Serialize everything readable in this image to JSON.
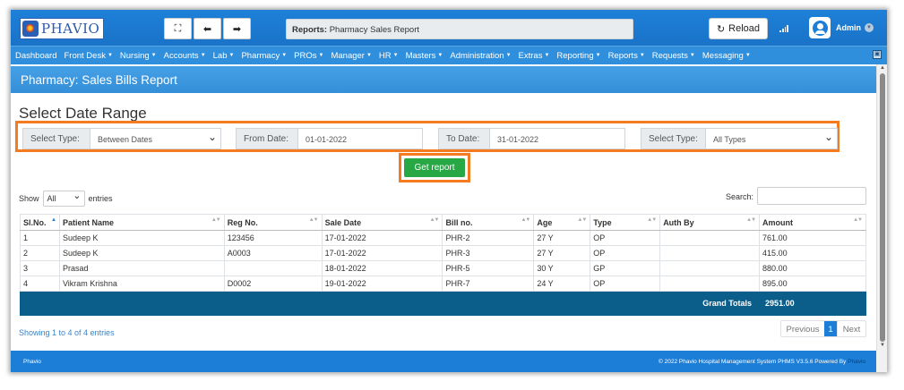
{
  "app": {
    "logo_text": "PHAVIO",
    "breadcrumb_prefix": "Reports:",
    "breadcrumb_page": "Pharmacy Sales Report",
    "reload_label": "Reload",
    "user": "Admin"
  },
  "toolbar": {
    "expand_icon": "expand-icon",
    "back_icon": "arrow-left-icon",
    "forward_icon": "arrow-right-icon"
  },
  "nav": [
    {
      "label": "Dashboard",
      "caret": false
    },
    {
      "label": "Front Desk",
      "caret": true
    },
    {
      "label": "Nursing",
      "caret": true
    },
    {
      "label": "Accounts",
      "caret": true
    },
    {
      "label": "Lab",
      "caret": true
    },
    {
      "label": "Pharmacy",
      "caret": true
    },
    {
      "label": "PROs",
      "caret": true
    },
    {
      "label": "Manager",
      "caret": true
    },
    {
      "label": "HR",
      "caret": true
    },
    {
      "label": "Masters",
      "caret": true
    },
    {
      "label": "Administration",
      "caret": true
    },
    {
      "label": "Extras",
      "caret": true
    },
    {
      "label": "Reporting",
      "caret": true
    },
    {
      "label": "Reports",
      "caret": true
    },
    {
      "label": "Requests",
      "caret": true
    },
    {
      "label": "Messaging",
      "caret": true
    }
  ],
  "page": {
    "title": "Pharmacy: Sales Bills Report",
    "section_title": "Select Date Range"
  },
  "filters": {
    "select_type_label": "Select Type:",
    "select_type_value": "Between Dates",
    "from_label": "From Date:",
    "from_value": "01-01-2022",
    "to_label": "To Date:",
    "to_value": "31-01-2022",
    "type2_label": "Select Type:",
    "type2_value": "All Types",
    "get_report_label": "Get report"
  },
  "table_controls": {
    "show_label": "Show",
    "show_value": "All",
    "entries_label": "entries",
    "search_label": "Search:"
  },
  "table": {
    "headers": [
      "Sl.No.",
      "Patient Name",
      "Reg No.",
      "Sale Date",
      "Bill no.",
      "Age",
      "Type",
      "Auth By",
      "Amount"
    ],
    "rows": [
      [
        "1",
        "Sudeep K",
        "123456",
        "17-01-2022",
        "PHR-2",
        "27 Y",
        "OP",
        "",
        "761.00"
      ],
      [
        "2",
        "Sudeep K",
        "A0003",
        "17-01-2022",
        "PHR-3",
        "27 Y",
        "OP",
        "",
        "415.00"
      ],
      [
        "3",
        "Prasad",
        "",
        "18-01-2022",
        "PHR-5",
        "30 Y",
        "GP",
        "",
        "880.00"
      ],
      [
        "4",
        "Vikram Krishna",
        "D0002",
        "19-01-2022",
        "PHR-7",
        "24 Y",
        "OP",
        "",
        "895.00"
      ]
    ],
    "grand_total_label": "Grand Totals",
    "grand_total_value": "2951.00"
  },
  "pagination": {
    "info": "Showing 1 to 4 of 4 entries",
    "previous": "Previous",
    "page": "1",
    "next": "Next"
  },
  "footer": {
    "left": "Phavio",
    "right": "© 2022 Phavio Hospital Management System PHMS V3.5.6 Powered By",
    "brand": "Phavio"
  },
  "colors": {
    "primary": "#1c7ed6",
    "highlight": "#f47b20",
    "success": "#28a745",
    "total_row": "#0b5e8a"
  }
}
